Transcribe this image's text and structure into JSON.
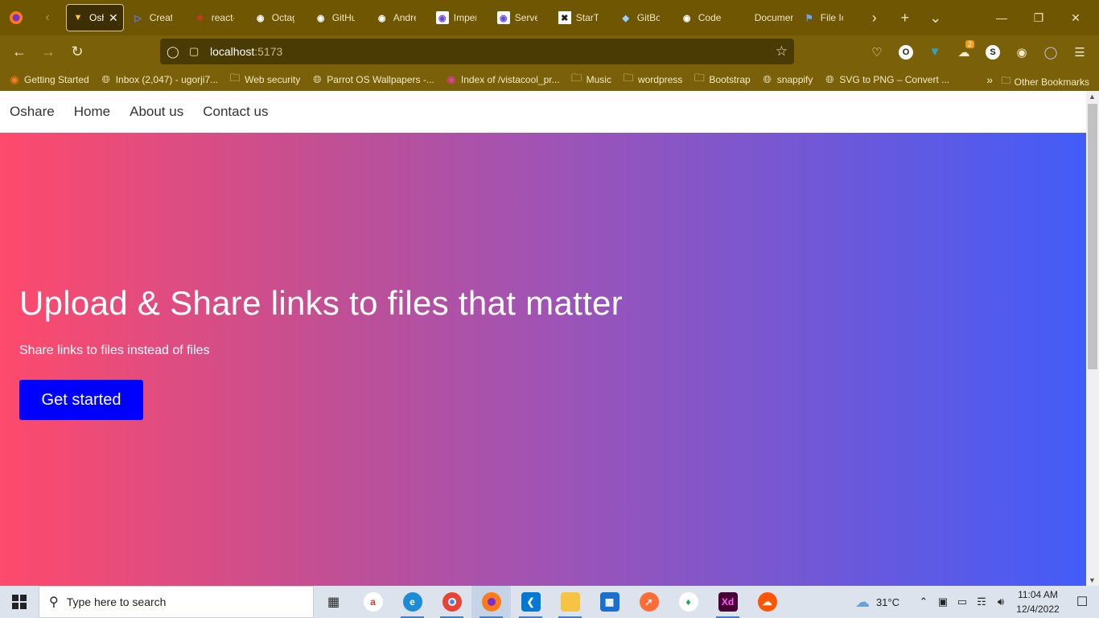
{
  "browser": {
    "tabs": [
      {
        "label": "Osh",
        "icon": "vite-icon",
        "active": true
      },
      {
        "label": "Create",
        "icon": "play-icon"
      },
      {
        "label": "react-",
        "icon": "react-icon"
      },
      {
        "label": "Octag",
        "icon": "github-icon"
      },
      {
        "label": "GitHu",
        "icon": "github-icon"
      },
      {
        "label": "Andre",
        "icon": "github-icon"
      },
      {
        "label": "Imper",
        "icon": "doc-icon"
      },
      {
        "label": "Server",
        "icon": "doc-icon"
      },
      {
        "label": "StarTu",
        "icon": "startup-icon"
      },
      {
        "label": "GitBo",
        "icon": "gitbook-icon"
      },
      {
        "label": "Code",
        "icon": "github-icon"
      },
      {
        "label": "Document",
        "icon": ""
      },
      {
        "label": "File Ic",
        "icon": "flag-icon"
      }
    ],
    "url_host": "localhost",
    "url_port": ":5173",
    "extension_badge": "2",
    "bookmarks": [
      {
        "label": "Getting Started",
        "icon": "firefox-icon"
      },
      {
        "label": "Inbox (2,047) - ugorji7...",
        "icon": "globe-icon"
      },
      {
        "label": "Web security",
        "icon": "folder-icon"
      },
      {
        "label": "Parrot OS Wallpapers -...",
        "icon": "globe-icon"
      },
      {
        "label": "Index of /vistacool_pr...",
        "icon": "record-icon"
      },
      {
        "label": "Music",
        "icon": "folder-icon"
      },
      {
        "label": "wordpress",
        "icon": "folder-icon"
      },
      {
        "label": "Bootstrap",
        "icon": "folder-icon"
      },
      {
        "label": "snappify",
        "icon": "globe-icon"
      },
      {
        "label": "SVG to PNG – Convert ...",
        "icon": "globe-icon"
      }
    ],
    "other_bookmarks": "Other Bookmarks"
  },
  "site": {
    "nav": {
      "brand": "Oshare",
      "home": "Home",
      "about": "About us",
      "contact": "Contact us"
    },
    "hero": {
      "title": "Upload & Share links to files that matter",
      "subtitle": "Share links to files instead of files",
      "cta": "Get started"
    }
  },
  "taskbar": {
    "search_placeholder": "Type here to search",
    "temperature": "31°C",
    "time": "11:04 AM",
    "date": "12/4/2022",
    "apps": [
      "task-view",
      "acrobat",
      "edge",
      "chrome",
      "firefox",
      "vscode",
      "file-explorer",
      "microsoft-store",
      "postman",
      "mongodb-compass",
      "adobe-xd",
      "soundcloud"
    ]
  },
  "colors": {
    "gradient_start": "#fe4a6c",
    "gradient_end": "#435cf8",
    "cta_bg": "#0000ff",
    "browser_chrome": "#7a6008"
  }
}
